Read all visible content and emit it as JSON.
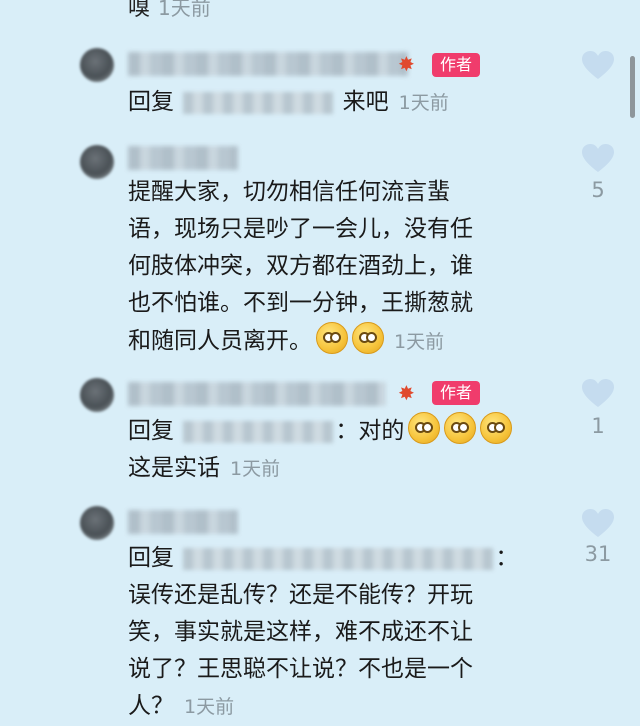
{
  "top_cut": {
    "text": "嗅",
    "time": "1天前"
  },
  "comments": [
    {
      "author_badge": "作者",
      "prefix": "回复",
      "body": "来吧",
      "time": "1天前",
      "likes": ""
    },
    {
      "body_lines": [
        "提醒大家，切勿相信任何流言蜚",
        "语，现场只是吵了一会儿，没有任",
        "何肢体冲突，双方都在酒劲上，谁",
        "也不怕谁。不到一分钟，王撕葱就",
        "和随同人员离开。"
      ],
      "time": "1天前",
      "likes": "5"
    },
    {
      "author_badge": "作者",
      "prefix": "回复",
      "body": "：对的",
      "line2": "这是实话",
      "time": "1天前",
      "likes": "1"
    },
    {
      "prefix": "回复",
      "line1_end": "：",
      "body_lines": [
        "误传还是乱传？还是不能传？开玩",
        "笑，事实就是这样，难不成还不让",
        "说了？王思聪不让说？不也是一个",
        "人？"
      ],
      "time": "1天前",
      "likes": "31"
    }
  ],
  "colors": {
    "background": "#d9eef8",
    "badge": "#f03c6c",
    "meta": "#8c9aa2",
    "heart": "#c5dcef"
  }
}
